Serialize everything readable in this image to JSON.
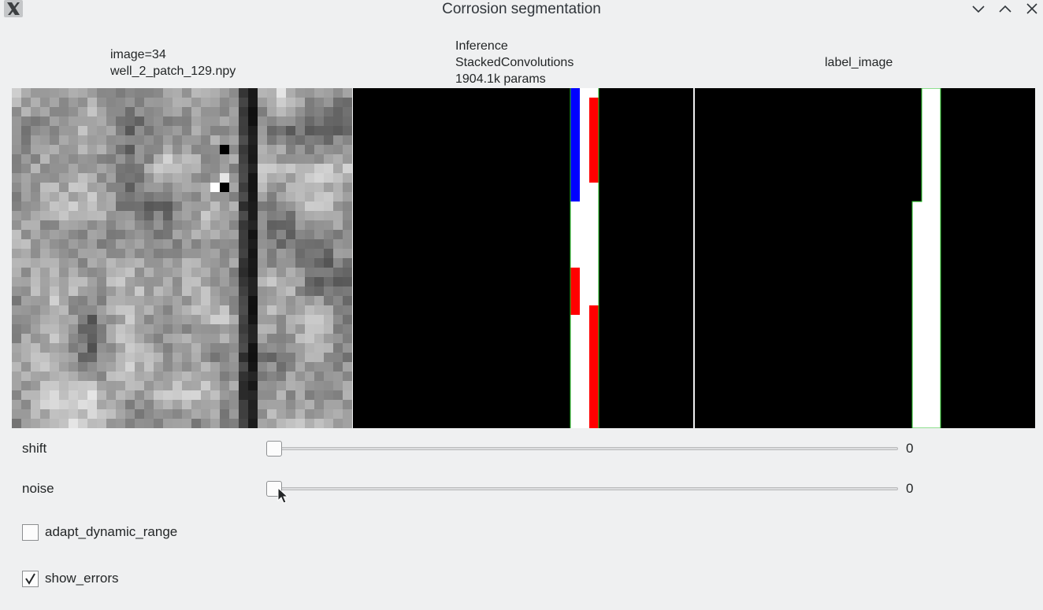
{
  "window": {
    "title": "Corrosion segmentation",
    "icons": [
      "x11-app-icon",
      "minimize-icon",
      "maximize-icon",
      "close-icon"
    ]
  },
  "panels": {
    "image": {
      "line1": "image=34",
      "line2": "well_2_patch_129.npy"
    },
    "inference": {
      "line1": "Inference",
      "line2": "StackedConvolutions",
      "line3": "1904.1k params"
    },
    "label": {
      "title": "label_image"
    }
  },
  "legend_colors": {
    "foreground": "#ffffff",
    "false_negative": "#0000ff",
    "false_positive": "#ff0000",
    "border": "#00c000"
  },
  "controls": {
    "shift": {
      "label": "shift",
      "value": "0",
      "min": 0
    },
    "noise": {
      "label": "noise",
      "value": "0",
      "min": 0
    },
    "adapt_dynamic_range": {
      "label": "adapt_dynamic_range",
      "checked": false
    },
    "show_errors": {
      "label": "show_errors",
      "checked": true
    }
  }
}
